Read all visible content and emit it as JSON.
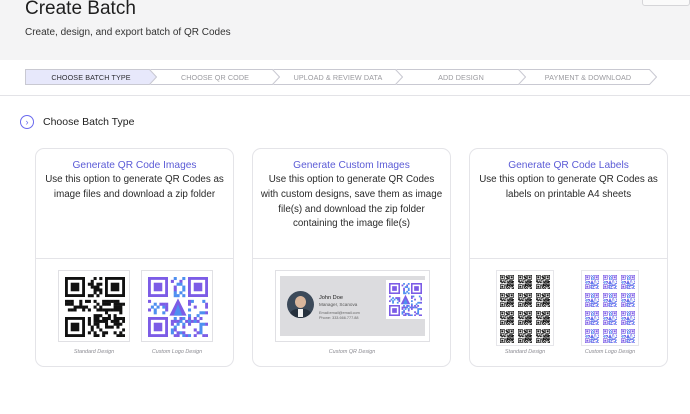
{
  "header": {
    "title": "Create Batch",
    "subtitle": "Create, design, and export batch of QR Codes"
  },
  "steps": [
    {
      "label": "CHOOSE BATCH TYPE",
      "active": true
    },
    {
      "label": "CHOOSE QR CODE",
      "active": false
    },
    {
      "label": "UPLOAD & REVIEW DATA",
      "active": false
    },
    {
      "label": "ADD DESIGN",
      "active": false
    },
    {
      "label": "PAYMENT & DOWNLOAD",
      "active": false
    }
  ],
  "section": {
    "icon": "chevron-right-circle-icon",
    "label": "Choose Batch Type"
  },
  "cards": [
    {
      "title": "Generate QR Code Images",
      "description": "Use this option to generate QR Codes as image files and download a zip folder",
      "previews": [
        {
          "caption": "Standard Design"
        },
        {
          "caption": "Custom Logo Design"
        }
      ]
    },
    {
      "title": "Generate Custom Images",
      "description": "Use this option to generate QR Codes with custom designs, save them as image file(s) and download the zip folder containing the image file(s)",
      "business_card": {
        "name": "John Doe",
        "role": "Manager, Scanova",
        "email": "Email:email@email.com",
        "phone": "Phone: 333.666.777.88"
      },
      "caption": "Custom QR Design"
    },
    {
      "title": "Generate QR Code Labels",
      "description": "Use this option to generate QR Codes as labels on printable A4 sheets",
      "previews": [
        {
          "caption": "Standard Design"
        },
        {
          "caption": "Custom Logo Design"
        }
      ]
    }
  ],
  "colors": {
    "accent": "#5b5bd6",
    "active_step_fill": "#e7e8fb",
    "logo_purple": "#7c5ce6",
    "logo_blue": "#4e8ff0"
  }
}
